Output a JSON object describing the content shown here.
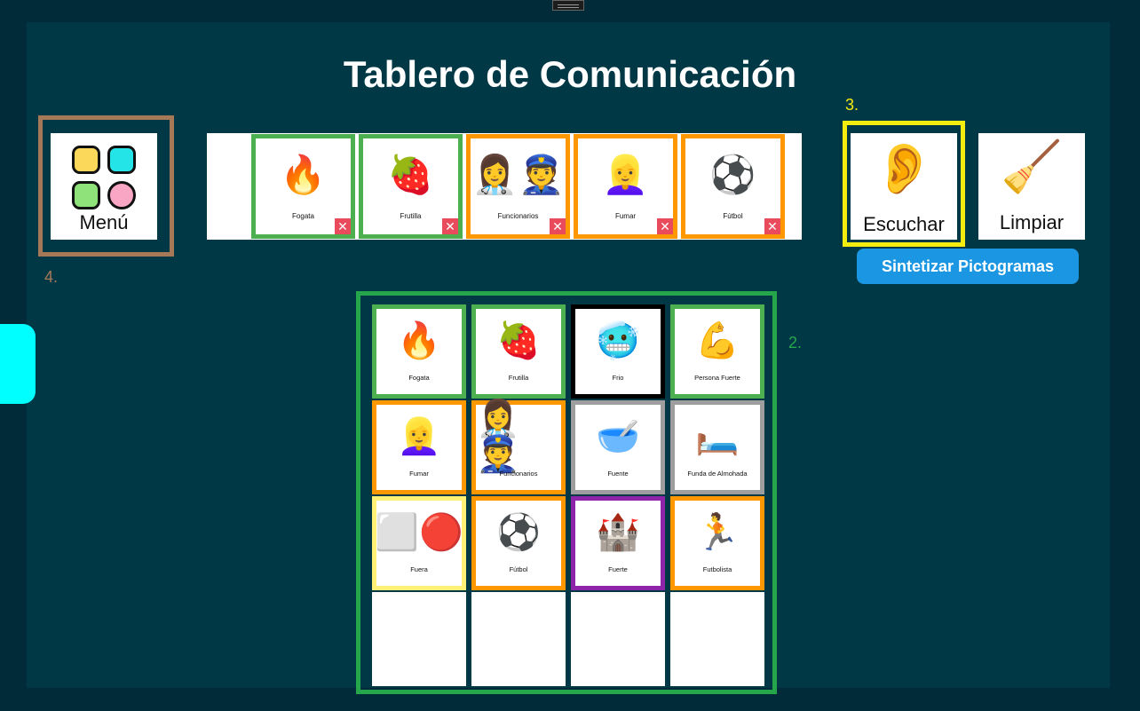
{
  "window": {
    "handle_icon": "drag-handle-icon"
  },
  "header": {
    "title": "Tablero de Comunicación"
  },
  "menu": {
    "label": "Menú",
    "icon": "grid-icon",
    "colors": [
      "#fbd85a",
      "#25e4e8",
      "#8fe27a",
      "#f9a6c4"
    ]
  },
  "sentence_strip": {
    "items": [
      {
        "label": "Fogata",
        "border": "#4caf50",
        "icon": "🔥"
      },
      {
        "label": "Frutilla",
        "border": "#4caf50",
        "icon": "🍓"
      },
      {
        "label": "Funcionarios",
        "border": "#ff9800",
        "icon": "👩‍⚕️👮"
      },
      {
        "label": "Fumar",
        "border": "#ff9800",
        "icon": "👱‍♀️"
      },
      {
        "label": "Fútbol",
        "border": "#ff9800",
        "icon": "⚽"
      }
    ],
    "remove_icon": "close-icon",
    "remove_glyph": "✕"
  },
  "actions": {
    "listen_label": "Escuchar",
    "listen_icon": "👂",
    "clear_label": "Limpiar",
    "clear_icon": "🧹",
    "synthesize_label": "Sintetizar Pictogramas"
  },
  "annotations": {
    "callout_2": "2.",
    "callout_3": "3.",
    "callout_4": "4.",
    "color_2": "#26a64b",
    "color_3": "#f5ed0f",
    "color_4": "#a57958"
  },
  "board": {
    "cells": [
      {
        "label": "Fogata",
        "border": "#4caf50",
        "icon": "🔥"
      },
      {
        "label": "Frutilla",
        "border": "#4caf50",
        "icon": "🍓"
      },
      {
        "label": "Frio",
        "border": "#000000",
        "icon": "🥶"
      },
      {
        "label": "Persona Fuerte",
        "border": "#4caf50",
        "icon": "💪"
      },
      {
        "label": "Fumar",
        "border": "#ff9800",
        "icon": "👱‍♀️"
      },
      {
        "label": "Funcionarios",
        "border": "#ff9800",
        "icon": "👩‍⚕️👮"
      },
      {
        "label": "Fuente",
        "border": "#9e9e9e",
        "icon": "🥣"
      },
      {
        "label": "Funda de Almohada",
        "border": "#9e9e9e",
        "icon": "🛏️"
      },
      {
        "label": "Fuera",
        "border": "#fff176",
        "icon": "⬜🔴"
      },
      {
        "label": "Fútbol",
        "border": "#ff9800",
        "icon": "⚽"
      },
      {
        "label": "Fuerte",
        "border": "#8e24aa",
        "icon": "🏰"
      },
      {
        "label": "Futbolista",
        "border": "#ff9800",
        "icon": "🏃"
      }
    ]
  }
}
